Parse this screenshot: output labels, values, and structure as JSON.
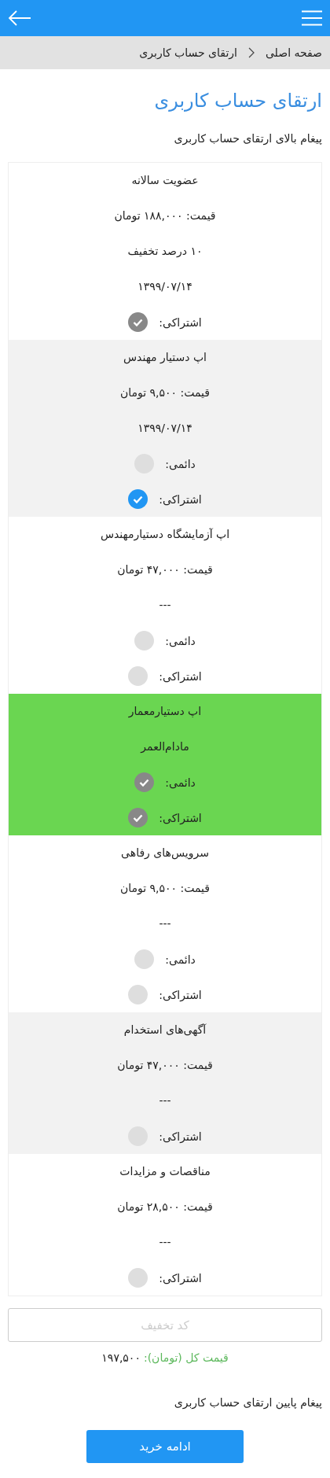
{
  "breadcrumb": {
    "home": "صفحه اصلی",
    "current": "ارتقای حساب کاربری"
  },
  "title": "ارتقای حساب کاربری",
  "top_message": "پیغام بالای ارتقای حساب کاربری",
  "plans": [
    {
      "name": "عضویت سالانه",
      "shaded": false,
      "highlighted": false,
      "lines": [
        "قیمت: ۱۸۸,۰۰۰ تومان",
        "۱۰ درصد تخفیف",
        "۱۳۹۹/۰۷/۱۴"
      ],
      "options": [
        {
          "label": "اشتراکی:",
          "checked": true,
          "disabled": true
        }
      ]
    },
    {
      "name": "اپ دستیار مهندس",
      "shaded": true,
      "highlighted": false,
      "lines": [
        "قیمت: ۹,۵۰۰ تومان",
        "۱۳۹۹/۰۷/۱۴"
      ],
      "options": [
        {
          "label": "دائمی:",
          "checked": false
        },
        {
          "label": "اشتراکی:",
          "checked": true,
          "disabled": false
        }
      ]
    },
    {
      "name": "اپ آزمایشگاه دستیارمهندس",
      "shaded": false,
      "highlighted": false,
      "lines": [
        "قیمت: ۴۷,۰۰۰ تومان",
        "---"
      ],
      "options": [
        {
          "label": "دائمی:",
          "checked": false
        },
        {
          "label": "اشتراکی:",
          "checked": false
        }
      ]
    },
    {
      "name": "اپ دستیارمعمار",
      "highlighted": true,
      "lines": [
        "مادام‌العمر"
      ],
      "options": [
        {
          "label": "دائمی:",
          "checked": true,
          "disabled": true
        },
        {
          "label": "اشتراکی:",
          "checked": true,
          "disabled": true
        }
      ]
    },
    {
      "name": "سرویس‌های رفاهی",
      "shaded": false,
      "highlighted": false,
      "lines": [
        "قیمت: ۹,۵۰۰ تومان",
        "---"
      ],
      "options": [
        {
          "label": "دائمی:",
          "checked": false
        },
        {
          "label": "اشتراکی:",
          "checked": false
        }
      ]
    },
    {
      "name": "آگهی‌های استخدام",
      "shaded": true,
      "highlighted": false,
      "lines": [
        "قیمت: ۴۷,۰۰۰ تومان",
        "---"
      ],
      "options": [
        {
          "label": "اشتراکی:",
          "checked": false
        }
      ]
    },
    {
      "name": "مناقصات و مزایدات",
      "shaded": false,
      "highlighted": false,
      "lines": [
        "قیمت: ۲۸,۵۰۰ تومان",
        "---"
      ],
      "options": [
        {
          "label": "اشتراکی:",
          "checked": false
        }
      ]
    }
  ],
  "discount_field": {
    "placeholder": "کد تخفیف"
  },
  "total": {
    "label": "قیمت کل (تومان):",
    "value": "۱۹۷,۵۰۰"
  },
  "bottom_message": "پیغام پایین ارتقای حساب کاربری",
  "continue_button": "ادامه خرید"
}
